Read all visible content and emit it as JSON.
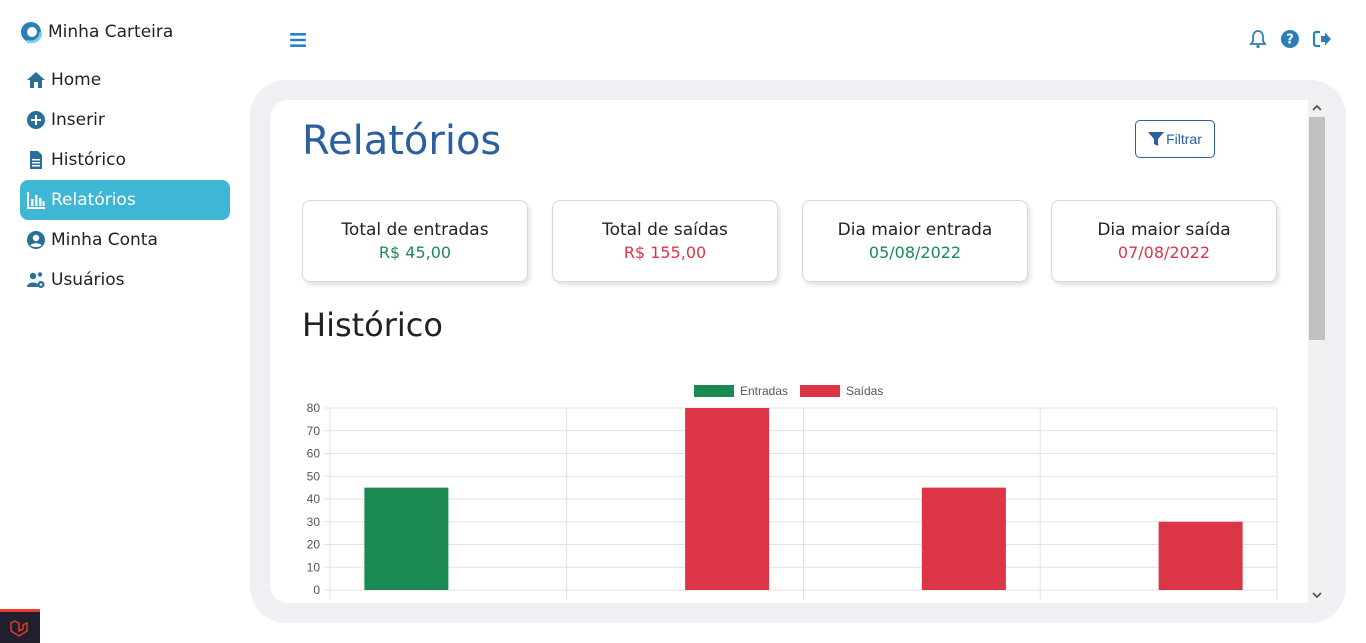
{
  "app": {
    "name": "Minha Carteira"
  },
  "sidebar": {
    "items": [
      {
        "label": "Home",
        "icon": "home-icon"
      },
      {
        "label": "Inserir",
        "icon": "plus-circle-icon"
      },
      {
        "label": "Histórico",
        "icon": "document-icon"
      },
      {
        "label": "Relatórios",
        "icon": "chart-bar-icon",
        "active": true
      },
      {
        "label": "Minha Conta",
        "icon": "user-circle-icon"
      },
      {
        "label": "Usuários",
        "icon": "users-cog-icon"
      }
    ]
  },
  "header": {
    "icons": [
      "menu-icon",
      "bell-icon",
      "help-icon",
      "logout-icon"
    ]
  },
  "page": {
    "title": "Relatórios",
    "filter_label": "Filtrar",
    "section_title": "Histórico"
  },
  "stats": [
    {
      "label": "Total de entradas",
      "value": "R$ 45,00",
      "tone": "green"
    },
    {
      "label": "Total de saídas",
      "value": "R$ 155,00",
      "tone": "red"
    },
    {
      "label": "Dia maior entrada",
      "value": "05/08/2022",
      "tone": "green"
    },
    {
      "label": "Dia maior saída",
      "value": "07/08/2022",
      "tone": "red"
    }
  ],
  "colors": {
    "accent": "#3fb6d6",
    "primary": "#2a5fa0",
    "green": "#1a8a52",
    "red": "#dc3545"
  },
  "chart_data": {
    "type": "bar",
    "categories": [
      "",
      "",
      "",
      ""
    ],
    "series": [
      {
        "name": "Entradas",
        "color": "#1a8a52",
        "values": [
          45,
          0,
          0,
          0
        ]
      },
      {
        "name": "Saídas",
        "color": "#dc3545",
        "values": [
          0,
          80,
          45,
          30
        ]
      }
    ],
    "ylim": [
      0,
      80
    ],
    "yticks": [
      "80",
      "70",
      "60",
      "50",
      "40",
      "30",
      "20",
      "10",
      "0"
    ],
    "legend": "top-center",
    "grid": true
  }
}
